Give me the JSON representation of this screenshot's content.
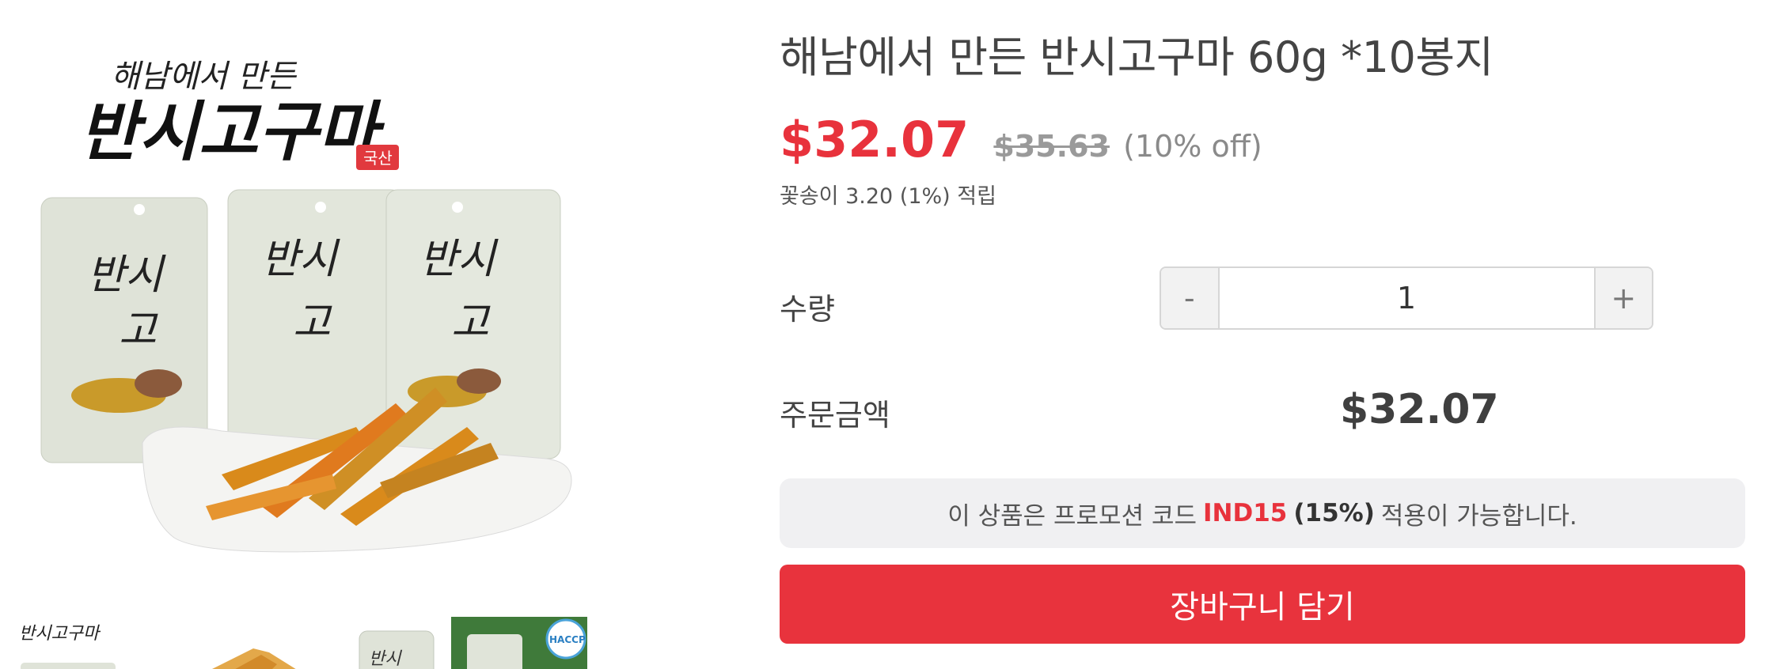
{
  "product": {
    "title": "해남에서 만든 반시고구마 60g *10봉지",
    "image_logo_text_top": "해남에서 만든",
    "image_logo_text_main": "반시고구마",
    "image_badge": "국산",
    "thumb_label": "HACCP"
  },
  "price": {
    "sale": "$32.07",
    "original": "$35.63",
    "discount": "(10% off)",
    "points": "꽃송이 3.20 (1%) 적립"
  },
  "quantity": {
    "label": "수량",
    "minus": "-",
    "value": "1",
    "plus": "+"
  },
  "total": {
    "label": "주문금액",
    "value": "$32.07"
  },
  "promo": {
    "prefix": "이 상품은 프로모션 코드",
    "code": "IND15",
    "percent": "(15%)",
    "suffix": "적용이 가능합니다."
  },
  "cart_button": "장바구니 담기",
  "colors": {
    "accent_red": "#e8323c",
    "promo_bg": "#f0f0f2",
    "text_dark": "#444444",
    "strike_gray": "#9a9a9a"
  }
}
